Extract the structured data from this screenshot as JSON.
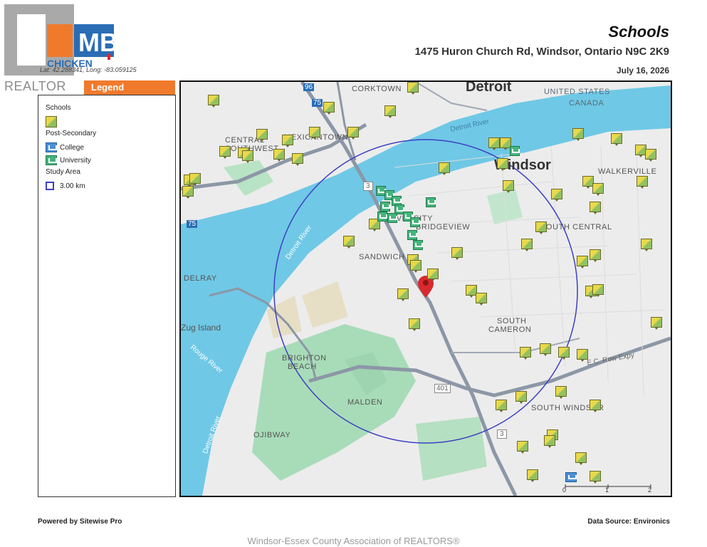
{
  "branding": {
    "logo_letters": "MB",
    "logo_word": "CHICKEN",
    "coords": "Lat: 42.288341, Long: -83.059125",
    "realtor_mark": "REALTOR"
  },
  "report": {
    "title": "Schools",
    "address": "1475 Huron Church Rd, Windsor, Ontario N9C 2K9",
    "date": "July 16, 2026"
  },
  "legend": {
    "header": "Legend",
    "schools_heading": "Schools",
    "post_secondary_heading": "Post-Secondary",
    "college_label": "College",
    "university_label": "University",
    "study_area_heading": "Study Area",
    "study_area_value": "3.00 km"
  },
  "map": {
    "labels": {
      "detroit": "Detroit",
      "windsor": "Windsor",
      "corktown": "CORKTOWN",
      "united_states": "UNITED STATES",
      "canada": "CANADA",
      "central_southwest_1": "CENTRAL",
      "central_southwest_2": "SOUTHWEST",
      "mexicantown": "MEXICANTOWN",
      "walkerville": "WALKERVILLE",
      "university": "UNIVERSITY",
      "bridgeview": "BRIDGEVIEW",
      "south_central": "SOUTH CENTRAL",
      "sandwich": "SANDWICH",
      "delray": "DELRAY",
      "south_cameron_1": "SOUTH",
      "south_cameron_2": "CAMERON",
      "zug_island": "Zug Island",
      "brighton_beach_1": "BRIGHTON",
      "brighton_beach_2": "BEACH",
      "malden": "MALDEN",
      "south_windsor": "SOUTH WINDSOR",
      "ojibway": "OJIBWAY",
      "detroit_river_top": "Detroit River",
      "detroit_river_mid": "Detroit River",
      "detroit_river_bottom": "Detroit River",
      "rouge_river": "Rouge River",
      "ec_row": "E.C. Row Expy",
      "hwy_401": "401",
      "hwy_3": "3",
      "i75": "75",
      "i96": "96"
    },
    "scale": {
      "tick_0": "0",
      "tick_1": "1",
      "tick_2": "2"
    },
    "colors": {
      "water": "#6fc8e6",
      "parkland": "#a5dcb7",
      "land": "#ececec",
      "highway": "#8c97a6",
      "study_ring": "#3c3fc2",
      "subject_pin": "#d8292f"
    }
  },
  "footer": {
    "powered_by": "Powered by Sitewise Pro",
    "data_source": "Data Source: Environics",
    "watermark": "Windsor-Essex County Association of REALTORS®"
  }
}
